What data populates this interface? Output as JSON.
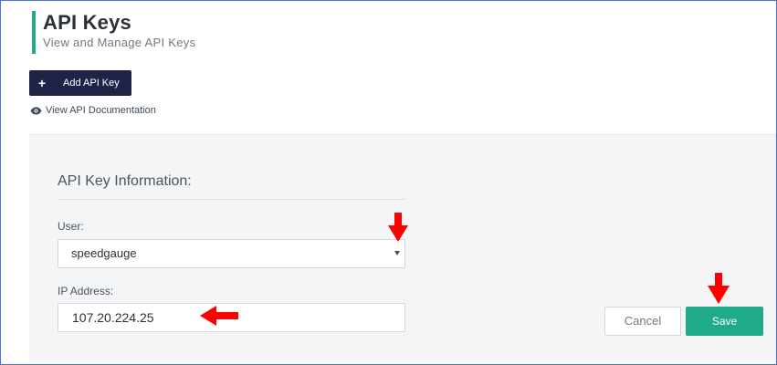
{
  "header": {
    "title": "API Keys",
    "subtitle": "View and Manage API Keys"
  },
  "actions": {
    "add_label": "Add API Key",
    "add_icon": "plus-icon",
    "doc_link_label": "View API Documentation",
    "doc_link_icon": "eye-icon"
  },
  "form": {
    "section_title": "API Key Information:",
    "user": {
      "label": "User:",
      "value": "speedgauge"
    },
    "ip": {
      "label": "IP Address:",
      "value": "107.20.224.25"
    },
    "cancel_label": "Cancel",
    "save_label": "Save"
  },
  "colors": {
    "accent": "#1faa8b",
    "primary_button": "#1f2347",
    "annotation": "#ff0000",
    "frame_border": "#4a74c9"
  }
}
